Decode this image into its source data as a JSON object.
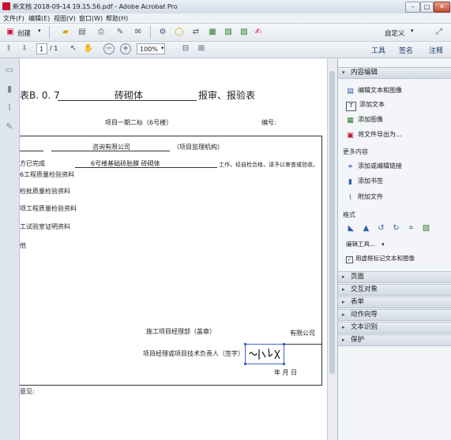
{
  "window": {
    "title": "新文档 2018-09-14 19.15.56.pdf - Adobe Acrobat Pro",
    "controls": [
      "–",
      "□",
      "✕"
    ]
  },
  "menu": [
    "文件(F)",
    "编辑(E)",
    "视图(V)",
    "窗口(W)",
    "帮助(H)"
  ],
  "toolbar": {
    "create_label": "创建",
    "customize_label": "自定义"
  },
  "nav": {
    "page_current": "1",
    "page_total": "/ 1",
    "zoom": "100%"
  },
  "tabs": [
    "工具",
    "签名",
    "注释"
  ],
  "document": {
    "table_no": "表B. 0. 7",
    "title_fill": "砖砌体",
    "title_rest": "报审、报验表",
    "project": "项目一期二标（6号楼）",
    "code_label": "编号:",
    "company": "咨询有限公司",
    "supervisor": "（项目监理机构）",
    "completed": "方已完成",
    "work_item": "6号楼基础砖胎膜 砖砌体",
    "work_rest": "工作，经自检合格，请予以审查或验收。",
    "attach1": "6工程质量检验资料",
    "attach2": "检批质量检验资料",
    "attach3": "项工程质量检验资料",
    "attach4": "工试验室证明资料",
    "attach5": "他",
    "dept_label": "施工项目经理部（盖章）",
    "company_suffix": "有限公司",
    "manager_label": "项目经理或项目技术负责人（签字）",
    "date_label": "年    月    日",
    "opinion": "意见:"
  },
  "panel": {
    "content_edit": "内容编辑",
    "items1": [
      "编辑文本和图像",
      "添加文本",
      "添加图像",
      "将文件导出为..."
    ],
    "more_content": "更多内容",
    "items2": [
      "添加或编辑链接",
      "添加书签",
      "附加文件"
    ],
    "format": "格式",
    "edit_tool": "编辑工具...",
    "checkbox_label": "用虚框标记文本和图像",
    "sections": [
      "页面",
      "交互对象",
      "表单",
      "动作向导",
      "文本识别",
      "保护"
    ]
  }
}
